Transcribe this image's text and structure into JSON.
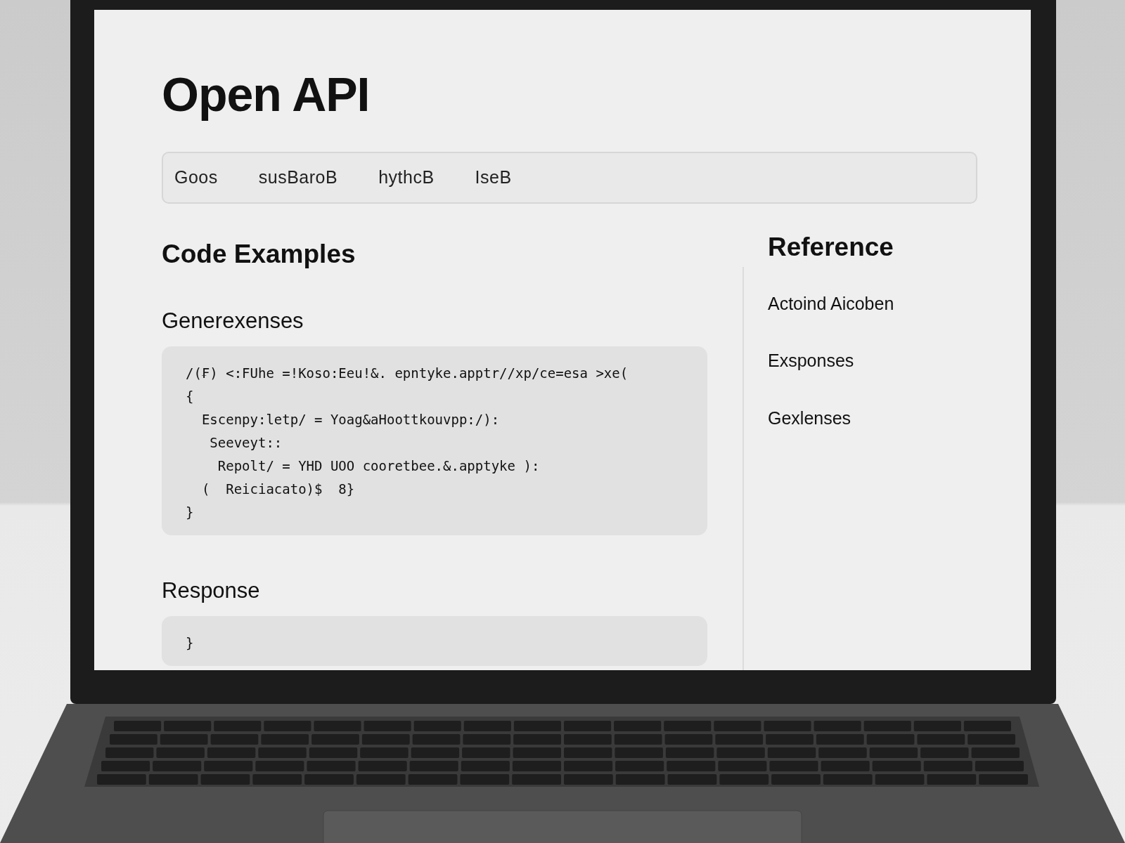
{
  "page": {
    "title": "Open API"
  },
  "tabs": [
    {
      "label": "Goos"
    },
    {
      "label": "susBaroB"
    },
    {
      "label": "hythcB"
    },
    {
      "label": "IseB"
    }
  ],
  "main": {
    "heading": "Code Examples",
    "sections": [
      {
        "title": "Generexenses",
        "code": [
          "/(₣) <:FUhe =!Koso:Eeu!&. epntyke.apptr//xp/ce=esa >xe(",
          "{",
          "  Escenpy:letp/ = Yoag&aHoottkouvpp:/):",
          "   Seeveyt::",
          "    Repolt/ = YHD UOO cooretbee.&.apptyke ):",
          "  (  Reiciacato)$  8}",
          "}"
        ]
      },
      {
        "title": "Response",
        "code": [
          "}"
        ]
      }
    ]
  },
  "reference": {
    "heading": "Reference",
    "items": [
      "Actoind Aicoben",
      "Exsponses",
      "Gexlenses"
    ]
  }
}
